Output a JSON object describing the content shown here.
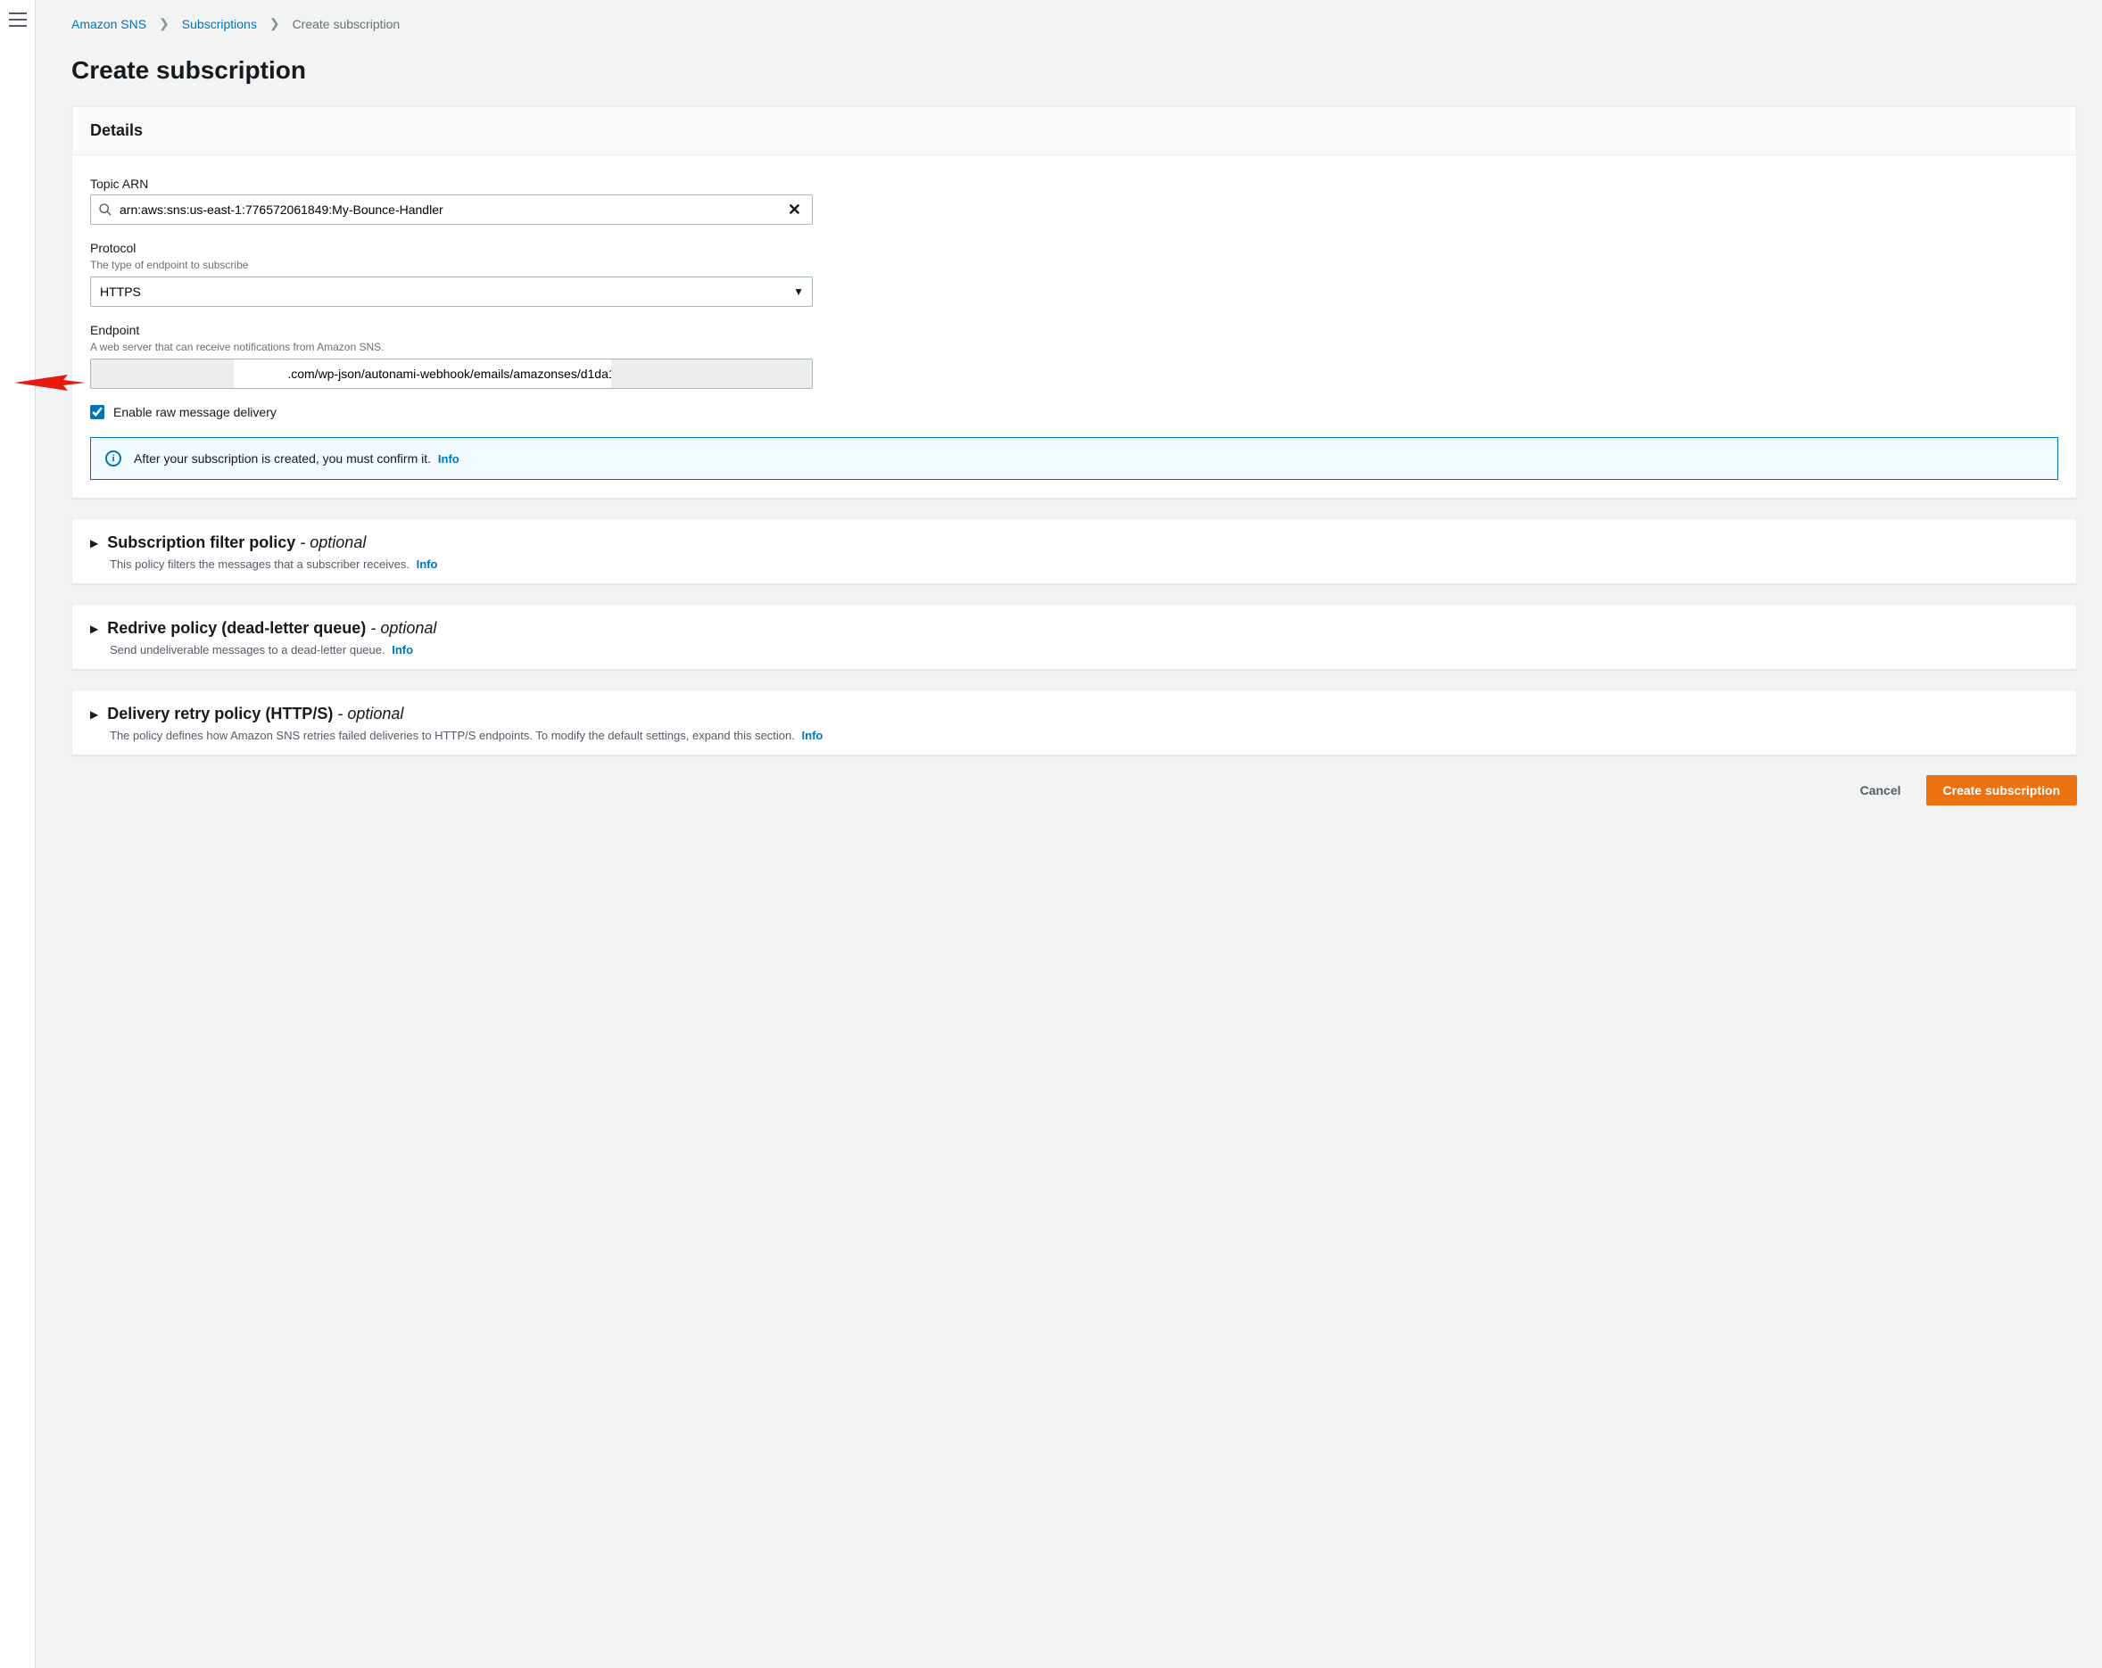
{
  "breadcrumb": {
    "items": [
      {
        "label": "Amazon SNS",
        "href": "#"
      },
      {
        "label": "Subscriptions",
        "href": "#"
      }
    ],
    "current": "Create subscription"
  },
  "page_title": "Create subscription",
  "details": {
    "header": "Details",
    "topic_arn": {
      "label": "Topic ARN",
      "value": "arn:aws:sns:us-east-1:776572061849:My-Bounce-Handler"
    },
    "protocol": {
      "label": "Protocol",
      "hint": "The type of endpoint to subscribe",
      "value": "HTTPS"
    },
    "endpoint": {
      "label": "Endpoint",
      "hint": "A web server that can receive notifications from Amazon SNS.",
      "value": ".com/wp-json/autonami-webhook/emails/amazonses/d1da1"
    },
    "raw_delivery": {
      "label": "Enable raw message delivery",
      "checked": true
    },
    "confirm_notice": "After your subscription is created, you must confirm it.",
    "info_link": "Info"
  },
  "sections": {
    "filter": {
      "title": "Subscription filter policy",
      "optional": "- optional",
      "desc": "This policy filters the messages that a subscriber receives.",
      "info": "Info"
    },
    "redrive": {
      "title": "Redrive policy (dead-letter queue)",
      "optional": "- optional",
      "desc": "Send undeliverable messages to a dead-letter queue.",
      "info": "Info"
    },
    "retry": {
      "title": "Delivery retry policy (HTTP/S)",
      "optional": "- optional",
      "desc": "The policy defines how Amazon SNS retries failed deliveries to HTTP/S endpoints. To modify the default settings, expand this section.",
      "info": "Info"
    }
  },
  "footer": {
    "cancel": "Cancel",
    "create": "Create subscription"
  }
}
